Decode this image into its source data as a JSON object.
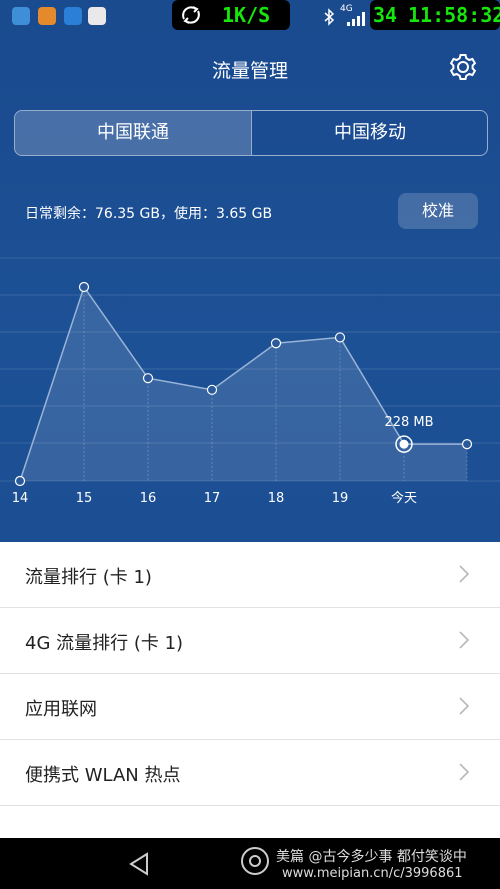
{
  "status_bar": {
    "net_speed": "1K/S",
    "network_type": "4G",
    "battery": "34",
    "time": "11:58:32"
  },
  "header": {
    "title": "流量管理",
    "tabs": [
      {
        "label": "中国联通",
        "selected": true
      },
      {
        "label": "中国移动",
        "selected": false
      }
    ]
  },
  "usage": {
    "summary": "日常剩余：76.35 GB，使用：3.65 GB",
    "calibrate_label": "校准"
  },
  "chart_data": {
    "type": "line",
    "categories": [
      "14",
      "15",
      "16",
      "17",
      "18",
      "19",
      "今天",
      ""
    ],
    "values": [
      0,
      1,
      0.53,
      0.47,
      0.71,
      0.74,
      0.19,
      0.19
    ],
    "highlight_index": 6,
    "highlight_label": "228 MB",
    "grid": true,
    "line_color": "#9ab4d8"
  },
  "list": {
    "items": [
      {
        "label": "流量排行 (卡 1)"
      },
      {
        "label": "4G 流量排行 (卡 1)"
      },
      {
        "label": "应用联网"
      },
      {
        "label": "便携式 WLAN 热点"
      }
    ]
  },
  "watermark": {
    "line1": "美篇 @古今多少事 都付笑谈中",
    "line2": "www.meipian.cn/c/3996861"
  }
}
